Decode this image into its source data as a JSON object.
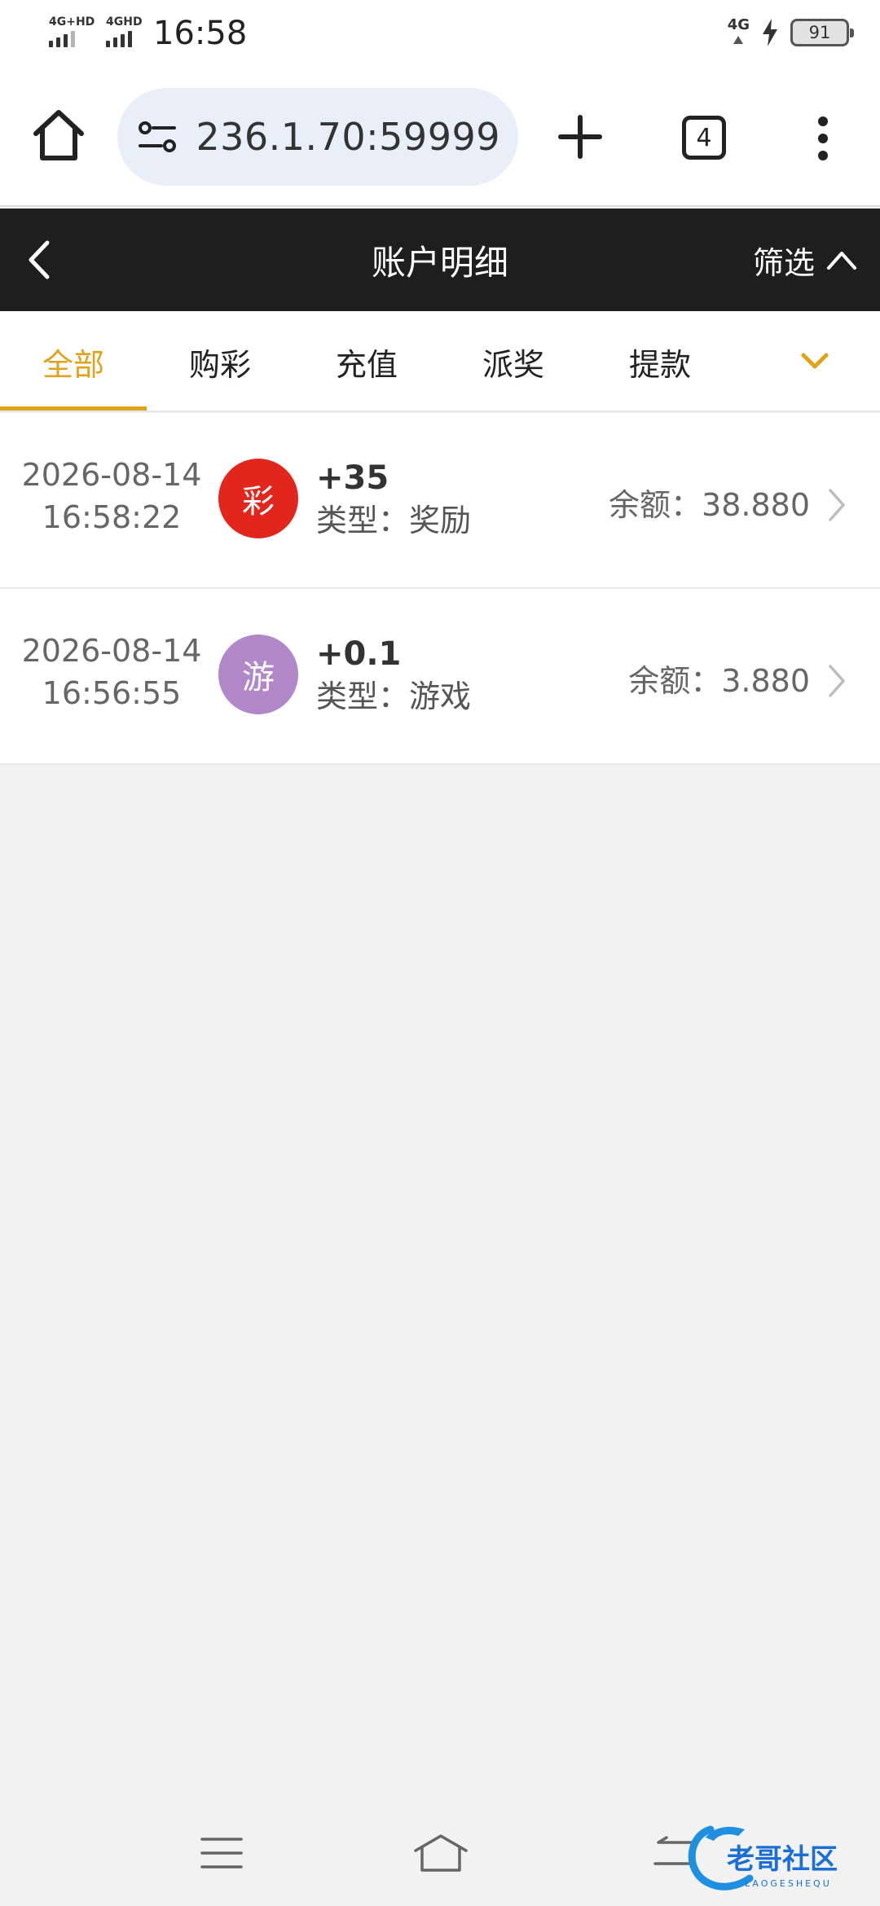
{
  "status_bar": {
    "time": "16:58",
    "sim1_label": "4G+HD",
    "sim2_label": "4GHD",
    "net_right": "4G",
    "battery": "91"
  },
  "browser": {
    "url": "236.1.70:59999",
    "tab_count": "4",
    "icons": [
      "home-icon",
      "tune-icon",
      "plus-icon",
      "tabs-icon",
      "more-vert-icon"
    ]
  },
  "header": {
    "title": "账户明细",
    "filter_label": "筛选"
  },
  "tabs": [
    {
      "label": "全部",
      "active": true
    },
    {
      "label": "购彩",
      "active": false
    },
    {
      "label": "充值",
      "active": false
    },
    {
      "label": "派奖",
      "active": false
    },
    {
      "label": "提款",
      "active": false
    }
  ],
  "records": [
    {
      "date": "2026-08-14",
      "time": "16:58:22",
      "badge": "彩",
      "badge_color": "#e3261d",
      "amount": "+35",
      "type": "类型：奖励",
      "balance": "余额：38.880"
    },
    {
      "date": "2026-08-14",
      "time": "16:56:55",
      "badge": "游",
      "badge_color": "#b187c7",
      "amount": "+0.1",
      "type": "类型：游戏",
      "balance": "余额：3.880"
    }
  ],
  "watermark": {
    "text": "老哥社区",
    "subtext": "LAOGESHEQU"
  },
  "colors": {
    "accent": "#e0a21a",
    "header_bg": "#1e1e1e",
    "page_bg": "#f2f2f3",
    "url_pill": "#e8eff9"
  }
}
